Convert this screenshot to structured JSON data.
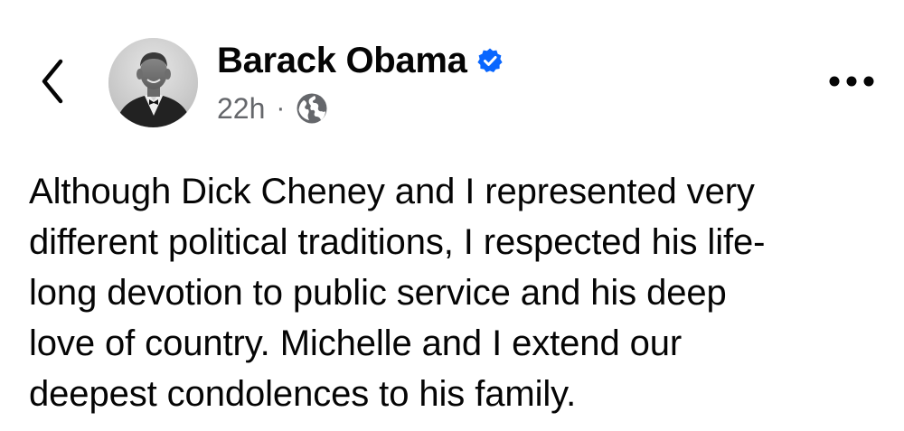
{
  "post": {
    "author": {
      "name": "Barack Obama",
      "verified": true,
      "avatar_icon": "person-photo-avatar"
    },
    "timestamp": "22h",
    "separator": "·",
    "audience_icon": "globe-icon",
    "text_lines": [
      "Although Dick Cheney and I represented very",
      "different political traditions, I respected his life-",
      "long devotion to public service and his deep",
      "love of country. Michelle and I extend our",
      "deepest condolences to his family."
    ]
  },
  "icons": {
    "back": "chevron-left-icon",
    "verified": "verified-badge-icon",
    "more": "more-options-icon"
  },
  "colors": {
    "verified_blue": "#0866ff",
    "secondary_text": "#65676b",
    "primary_text": "#050505",
    "background": "#ffffff"
  }
}
